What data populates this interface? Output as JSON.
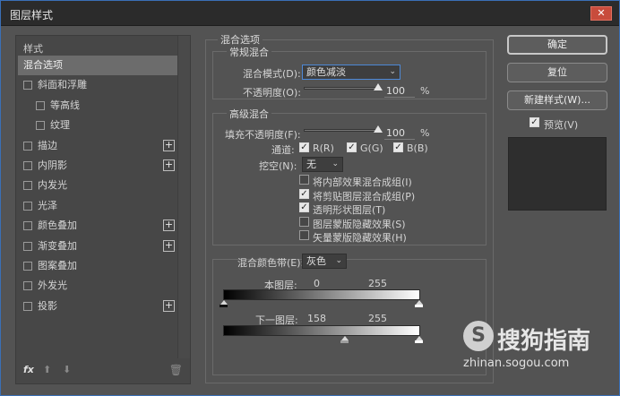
{
  "window": {
    "title": "图层样式",
    "close_glyph": "✕"
  },
  "left_panel": {
    "header": "样式",
    "items": [
      {
        "label": "混合选项",
        "checkbox": false,
        "plus": false,
        "selected": true,
        "indent": 0
      },
      {
        "label": "斜面和浮雕",
        "checkbox": true,
        "plus": false,
        "selected": false,
        "indent": 0
      },
      {
        "label": "等高线",
        "checkbox": true,
        "plus": false,
        "selected": false,
        "indent": 1
      },
      {
        "label": "纹理",
        "checkbox": true,
        "plus": false,
        "selected": false,
        "indent": 1
      },
      {
        "label": "描边",
        "checkbox": true,
        "plus": true,
        "selected": false,
        "indent": 0
      },
      {
        "label": "内阴影",
        "checkbox": true,
        "plus": true,
        "selected": false,
        "indent": 0
      },
      {
        "label": "内发光",
        "checkbox": true,
        "plus": false,
        "selected": false,
        "indent": 0
      },
      {
        "label": "光泽",
        "checkbox": true,
        "plus": false,
        "selected": false,
        "indent": 0
      },
      {
        "label": "颜色叠加",
        "checkbox": true,
        "plus": true,
        "selected": false,
        "indent": 0
      },
      {
        "label": "渐变叠加",
        "checkbox": true,
        "plus": true,
        "selected": false,
        "indent": 0
      },
      {
        "label": "图案叠加",
        "checkbox": true,
        "plus": false,
        "selected": false,
        "indent": 0
      },
      {
        "label": "外发光",
        "checkbox": true,
        "plus": false,
        "selected": false,
        "indent": 0
      },
      {
        "label": "投影",
        "checkbox": true,
        "plus": true,
        "selected": false,
        "indent": 0
      }
    ],
    "footer": {
      "fx": "fx",
      "up": "⬆",
      "down": "⬇",
      "trash": "🗑"
    }
  },
  "blending_options": {
    "title": "混合选项",
    "general": {
      "title": "常规混合",
      "blend_mode_label": "混合模式(D):",
      "blend_mode_value": "颜色减淡",
      "opacity_label": "不透明度(O):",
      "opacity_value": "100",
      "opacity_unit": "%",
      "opacity_level": 1.0
    },
    "advanced": {
      "title": "高级混合",
      "fill_opacity_label": "填充不透明度(F):",
      "fill_opacity_value": "100",
      "fill_opacity_unit": "%",
      "fill_opacity_level": 1.0,
      "channels_label": "通道:",
      "channel_r": "R(R)",
      "channel_g": "G(G)",
      "channel_b": "B(B)",
      "knockout_label": "挖空(N):",
      "knockout_value": "无",
      "options": [
        {
          "label": "将内部效果混合成组(I)",
          "checked": false
        },
        {
          "label": "将剪贴图层混合成组(P)",
          "checked": true
        },
        {
          "label": "透明形状图层(T)",
          "checked": true
        },
        {
          "label": "图层蒙版隐藏效果(S)",
          "checked": false
        },
        {
          "label": "矢量蒙版隐藏效果(H)",
          "checked": false
        }
      ]
    },
    "blend_if": {
      "label": "混合颜色带(E):",
      "value": "灰色",
      "this_layer_label": "本图层:",
      "this_layer_low": "0",
      "this_layer_high": "255",
      "underlying_label": "下一图层:",
      "underlying_low": "158",
      "underlying_high": "255"
    }
  },
  "buttons": {
    "ok": "确定",
    "reset": "复位",
    "new_style": "新建样式(W)...",
    "preview_label": "预览(V)"
  },
  "watermark": {
    "glyph": "S",
    "text": "搜狗指南",
    "url": "zhinan.sogou.com"
  }
}
